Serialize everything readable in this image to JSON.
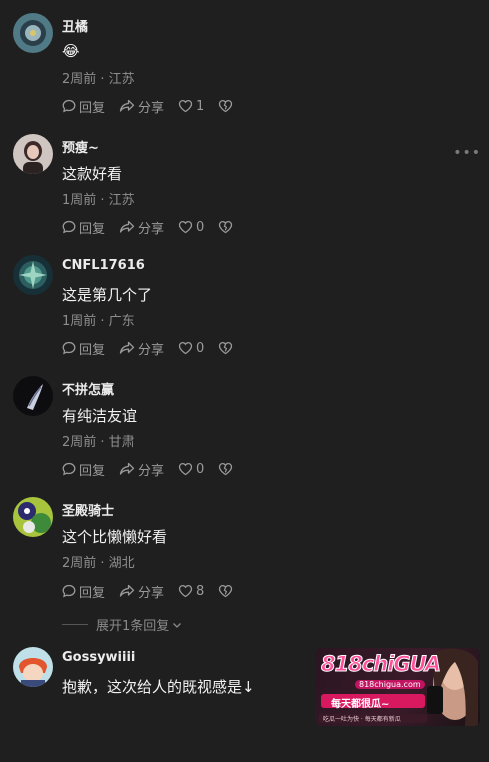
{
  "labels": {
    "reply": "回复",
    "share": "分享",
    "expand_replies": "展开1条回复"
  },
  "comments": [
    {
      "username": "丑橘",
      "content": "😂",
      "meta": "2周前 · 江苏",
      "likes": "1"
    },
    {
      "username": "预瘦~",
      "content": "这款好看",
      "meta": "1周前 · 江苏",
      "likes": "0"
    },
    {
      "username": "CNFL17616",
      "content": "这是第几个了",
      "meta": "1周前 · 广东",
      "likes": "0"
    },
    {
      "username": "不拼怎赢",
      "content": "有纯洁友谊",
      "meta": "2周前 · 甘肃",
      "likes": "0"
    },
    {
      "username": "圣殿骑士",
      "content": "这个比懒懒好看",
      "meta": "2周前 · 湖北",
      "likes": "8"
    },
    {
      "username": "Gossywiiii",
      "content": "抱歉，这次给人的既视感是↓"
    }
  ],
  "ad": {
    "logo": "818chiGUA",
    "url": "818chigua.com",
    "slogan": "每天都很瓜~",
    "sub": "吃瓜一吐为快 · 每天都有新瓜"
  },
  "colors": {
    "background": "#1f1f1f",
    "text": "#f2f2f2",
    "secondary": "#8e8e8e",
    "ad_pink": "#ff3d8a"
  }
}
